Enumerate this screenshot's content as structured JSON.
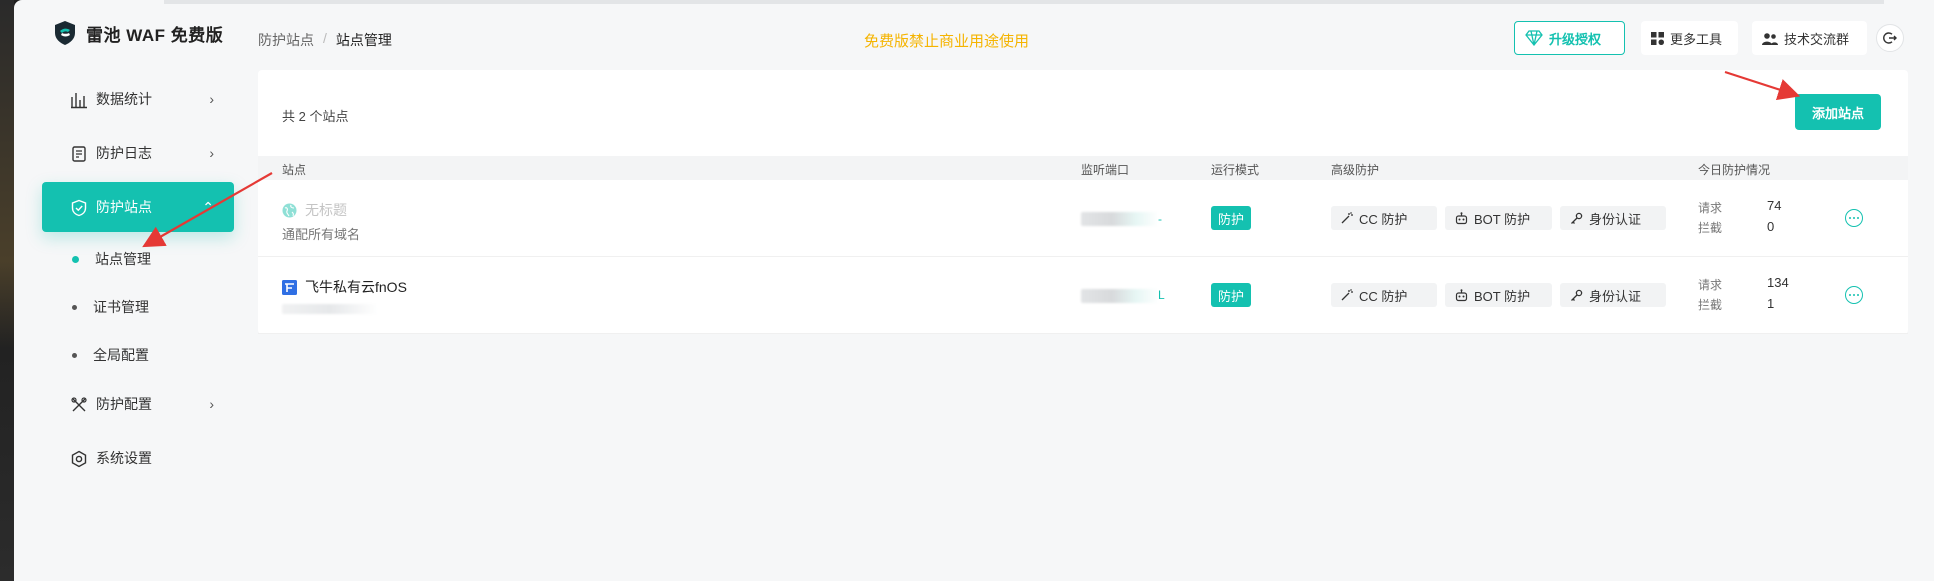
{
  "app": {
    "title": "雷池 WAF 免费版"
  },
  "sidebar": {
    "items": [
      {
        "label": "数据统计",
        "icon": "bar-chart-icon",
        "chevron": "›"
      },
      {
        "label": "防护日志",
        "icon": "log-icon",
        "chevron": "›"
      },
      {
        "label": "防护站点",
        "icon": "shield-icon",
        "chevron": "⌃"
      },
      {
        "label": "防护配置",
        "icon": "tools-icon",
        "chevron": "›"
      },
      {
        "label": "系统设置",
        "icon": "gear-icon"
      }
    ],
    "subitems": [
      {
        "label": "站点管理"
      },
      {
        "label": "证书管理"
      },
      {
        "label": "全局配置"
      }
    ]
  },
  "header": {
    "breadcrumb": [
      "防护站点",
      "/",
      "站点管理"
    ],
    "notice": "免费版禁止商业用途使用",
    "upgrade_label": "升级授权",
    "tools_label": "更多工具",
    "community_label": "技术交流群"
  },
  "main": {
    "total": "共 2 个站点",
    "add_label": "添加站点",
    "columns": [
      "站点",
      "监听端口",
      "运行模式",
      "高级防护",
      "今日防护情况"
    ],
    "rows": [
      {
        "name": "无标题",
        "sub": "通配所有域名",
        "port_tail": "-",
        "mode": "防护",
        "protections": [
          "CC 防护",
          "BOT 防护",
          "身份认证"
        ],
        "stats": {
          "req_label": "请求",
          "req": "74",
          "block_label": "拦截",
          "block": "0"
        }
      },
      {
        "name": "飞牛私有云fnOS",
        "sub": "",
        "port_tail": "L",
        "mode": "防护",
        "protections": [
          "CC 防护",
          "BOT 防护",
          "身份认证"
        ],
        "stats": {
          "req_label": "请求",
          "req": "134",
          "block_label": "拦截",
          "block": "1"
        }
      }
    ]
  },
  "colors": {
    "accent": "#14c1b0",
    "notice": "#f5b400",
    "annotation": "#e53935"
  }
}
